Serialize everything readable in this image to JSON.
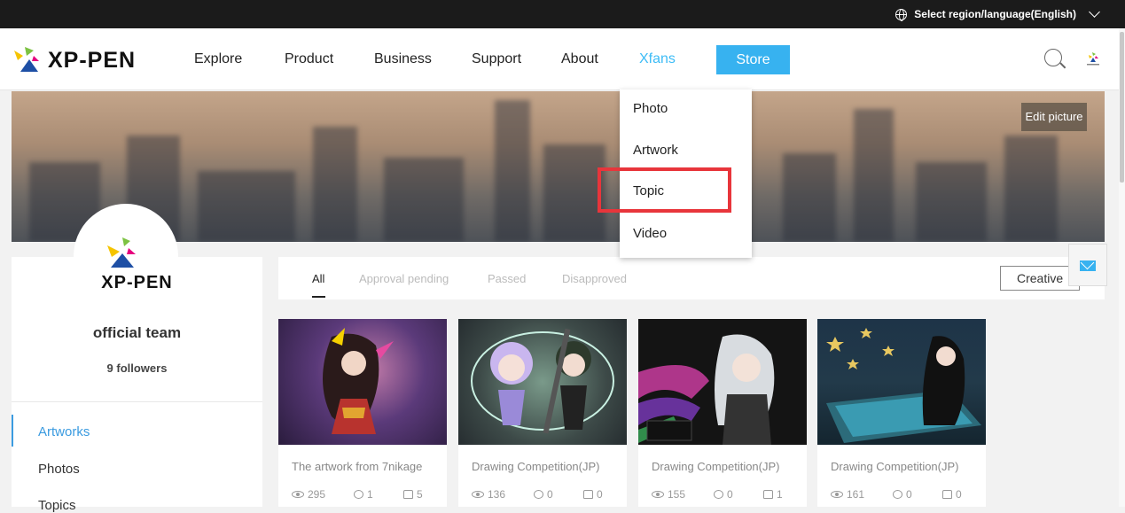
{
  "topbar": {
    "region_label": "Select region/language(English)"
  },
  "header": {
    "logo_text": "XP-PEN",
    "nav": [
      "Explore",
      "Product",
      "Business",
      "Support",
      "About",
      "Xfans"
    ],
    "active": "Xfans",
    "store_label": "Store"
  },
  "xfans_menu": [
    "Photo",
    "Artwork",
    "Topic",
    "Video"
  ],
  "highlighted_item": "Topic",
  "banner": {
    "edit_label": "Edit picture"
  },
  "profile": {
    "brand": "XP-PEN",
    "name": "official team",
    "followers": "9 followers",
    "sidebar": [
      "Artworks",
      "Photos",
      "Topics"
    ],
    "active_item": "Artworks"
  },
  "tabs": [
    "All",
    "Approval pending",
    "Passed",
    "Disapproved"
  ],
  "active_tab": "All",
  "creative_button": "Creative",
  "cards": [
    {
      "title": "The artwork from 7nikage",
      "views": "295",
      "comments": "1",
      "likes": "5"
    },
    {
      "title": "Drawing Competition(JP)",
      "views": "136",
      "comments": "0",
      "likes": "0"
    },
    {
      "title": "Drawing Competition(JP)",
      "views": "155",
      "comments": "0",
      "likes": "1"
    },
    {
      "title": "Drawing Competition(JP)",
      "views": "161",
      "comments": "0",
      "likes": "0"
    }
  ],
  "colors": {
    "accent": "#37b2f0",
    "highlight": "#e8353b",
    "active_nav": "#3dbcf6"
  }
}
